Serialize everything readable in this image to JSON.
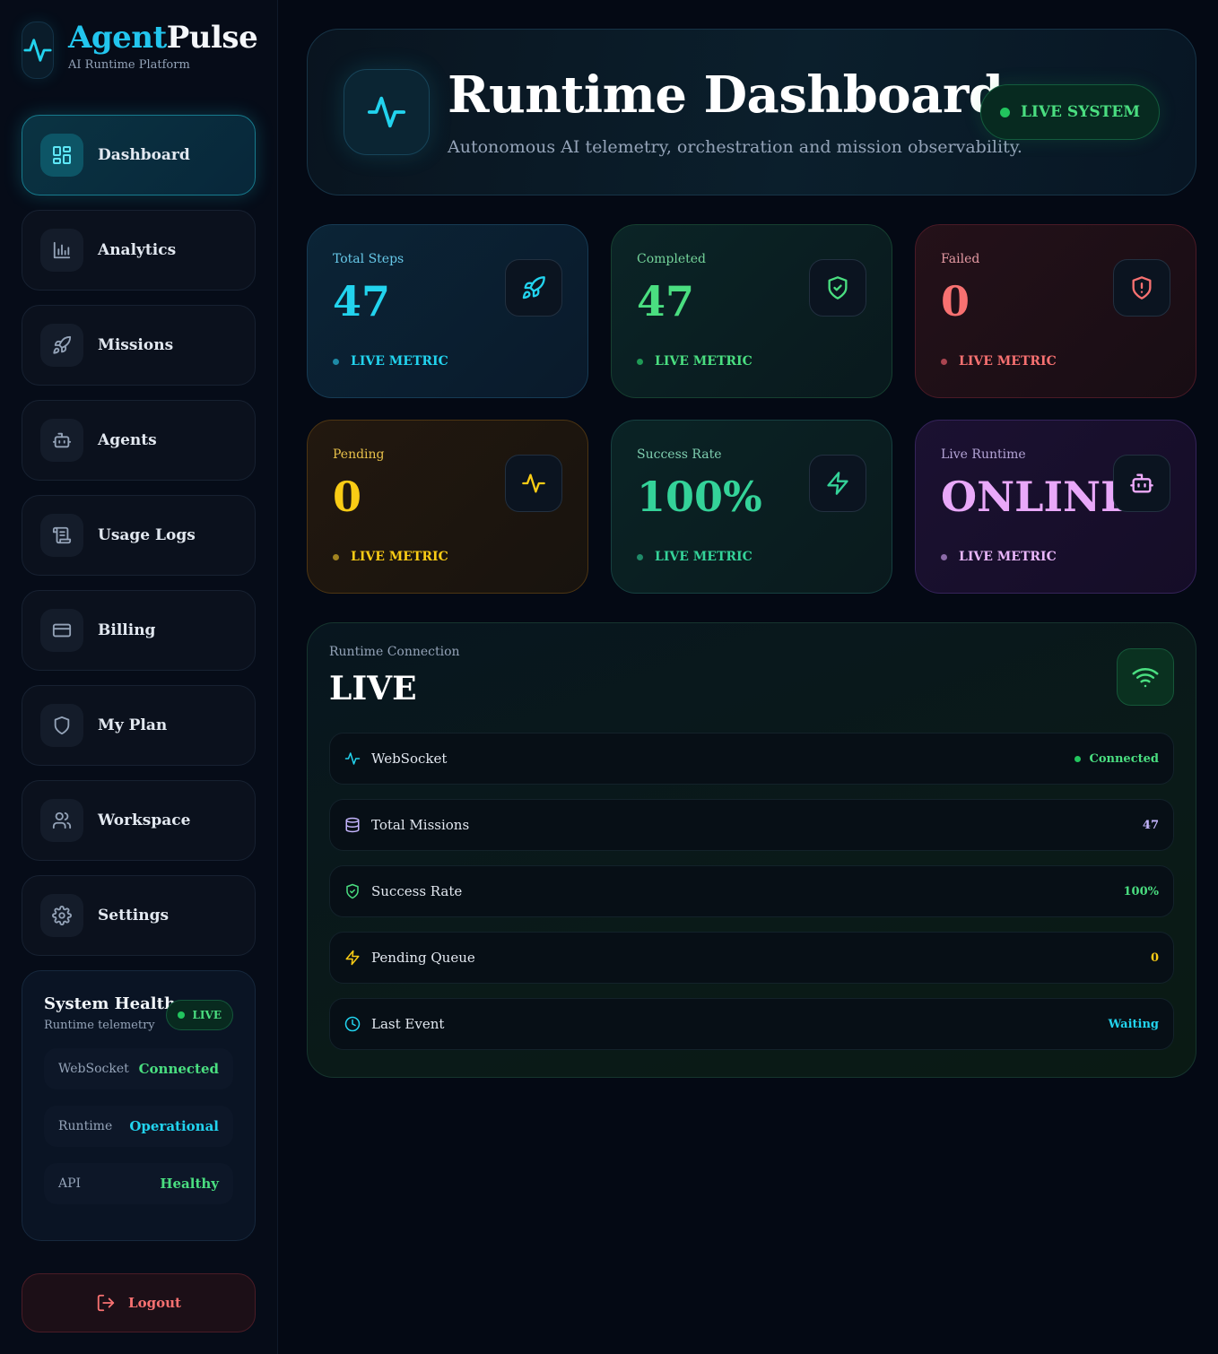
{
  "brand": {
    "name_part1": "Agent",
    "name_part2": "Pulse",
    "subtitle": "AI Runtime Platform"
  },
  "sidebar": {
    "items": [
      {
        "label": "Dashboard",
        "icon": "dashboard-icon",
        "active": true
      },
      {
        "label": "Analytics",
        "icon": "bar-chart-icon"
      },
      {
        "label": "Missions",
        "icon": "rocket-icon"
      },
      {
        "label": "Agents",
        "icon": "bot-icon"
      },
      {
        "label": "Usage Logs",
        "icon": "scroll-icon"
      },
      {
        "label": "Billing",
        "icon": "credit-card-icon"
      },
      {
        "label": "My Plan",
        "icon": "shield-icon"
      },
      {
        "label": "Workspace",
        "icon": "users-icon"
      },
      {
        "label": "Settings",
        "icon": "gear-icon"
      }
    ]
  },
  "health": {
    "title": "System Health",
    "subtitle": "Runtime telemetry",
    "badge": "LIVE",
    "rows": [
      {
        "key": "WebSocket",
        "value": "Connected",
        "color": "#4ade80"
      },
      {
        "key": "Runtime",
        "value": "Operational",
        "color": "#22d3ee"
      },
      {
        "key": "API",
        "value": "Healthy",
        "color": "#4ade80"
      }
    ]
  },
  "logout": {
    "label": "Logout"
  },
  "hero": {
    "title": "Runtime Dashboard",
    "subtitle": "Autonomous AI telemetry, orchestration and mission observability.",
    "badge": "LIVE SYSTEM"
  },
  "cards": [
    {
      "label": "Total Steps",
      "value": "47",
      "foot": "LIVE METRIC",
      "icon": "rocket-icon",
      "accent": "#22d3ee",
      "labelColor": "#67c8e8"
    },
    {
      "label": "Completed",
      "value": "47",
      "foot": "LIVE METRIC",
      "icon": "shield-check-icon",
      "accent": "#4ade80",
      "labelColor": "#74d49a"
    },
    {
      "label": "Failed",
      "value": "0",
      "foot": "LIVE METRIC",
      "icon": "shield-alert-icon",
      "accent": "#f87171",
      "labelColor": "#e59aa3"
    },
    {
      "label": "Pending",
      "value": "0",
      "foot": "LIVE METRIC",
      "icon": "activity-icon",
      "accent": "#facc15",
      "labelColor": "#e8c14a"
    },
    {
      "label": "Success Rate",
      "value": "100%",
      "foot": "LIVE METRIC",
      "icon": "zap-icon",
      "accent": "#34d399",
      "labelColor": "#7fcfb0"
    },
    {
      "label": "Live Runtime",
      "value": "ONLINE",
      "foot": "LIVE METRIC",
      "icon": "bot-icon",
      "accent": "#e879f9",
      "labelColor": "#b4a4d6"
    }
  ],
  "connection": {
    "label": "Runtime Connection",
    "title": "LIVE",
    "rows": [
      {
        "name": "WebSocket",
        "value": "Connected",
        "icon": "activity-icon",
        "iconColor": "#22d3ee",
        "valueColor": "#4ade80",
        "dot": true
      },
      {
        "name": "Total Missions",
        "value": "47",
        "icon": "database-icon",
        "iconColor": "#c4b5fd",
        "valueColor": "#c4b5fd",
        "dot": false
      },
      {
        "name": "Success Rate",
        "value": "100%",
        "icon": "shield-check-icon",
        "iconColor": "#4ade80",
        "valueColor": "#4ade80",
        "dot": false
      },
      {
        "name": "Pending Queue",
        "value": "0",
        "icon": "zap-icon",
        "iconColor": "#facc15",
        "valueColor": "#facc15",
        "dot": false
      },
      {
        "name": "Last Event",
        "value": "Waiting",
        "icon": "clock-icon",
        "iconColor": "#22d3ee",
        "valueColor": "#22d3ee",
        "dot": false
      }
    ]
  }
}
